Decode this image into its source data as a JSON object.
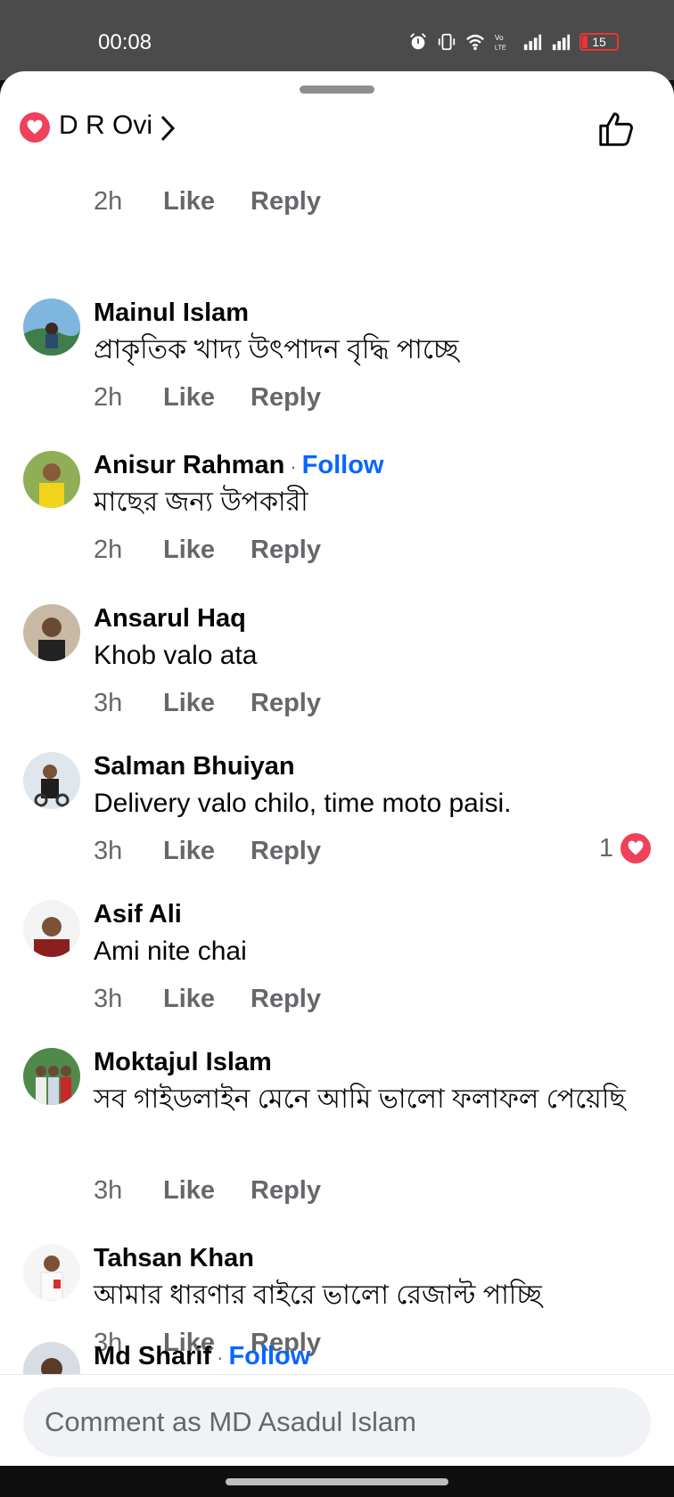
{
  "status_bar": {
    "time": "00:08",
    "battery": "15",
    "icons": [
      "alarm-icon",
      "vibrate-icon",
      "wifi-icon",
      "volte-icon",
      "signal-icon",
      "signal-icon",
      "battery-icon"
    ]
  },
  "header": {
    "page_name": "D R Ovi",
    "heart_icon": "heart-icon",
    "chevron_icon": "chevron-right-icon",
    "like_icon": "thumbs-up-icon"
  },
  "prev_comment_meta": {
    "time": "2h",
    "like": "Like",
    "reply": "Reply"
  },
  "comments": [
    {
      "name": "Mainul Islam",
      "text": "প্রাকৃতিক খাদ্য উৎপাদন বৃদ্ধি পাচ্ছে",
      "time": "2h",
      "like": "Like",
      "reply": "Reply"
    },
    {
      "name": "Anisur Rahman",
      "follow": "Follow",
      "text": "মাছের জন্য উপকারী",
      "time": "2h",
      "like": "Like",
      "reply": "Reply"
    },
    {
      "name": "Ansarul Haq",
      "text": "Khob valo ata",
      "time": "3h",
      "like": "Like",
      "reply": "Reply"
    },
    {
      "name": "Salman Bhuiyan",
      "text": "Delivery valo chilo, time moto paisi.",
      "time": "3h",
      "like": "Like",
      "reply": "Reply",
      "reaction_count": "1"
    },
    {
      "name": "Asif Ali",
      "text": "Ami nite chai",
      "time": "3h",
      "like": "Like",
      "reply": "Reply"
    },
    {
      "name": "Moktajul Islam",
      "text": "সব গাইডলাইন মেনে আমি ভালো ফলাফল পেয়েছি",
      "time": "3h",
      "like": "Like",
      "reply": "Reply"
    },
    {
      "name": "Tahsan Khan",
      "text": "আমার ধারণার বাইরে ভালো রেজাল্ট পাচ্ছি",
      "time": "3h",
      "like": "Like",
      "reply": "Reply"
    },
    {
      "name": "Md Sharif",
      "follow": "Follow"
    }
  ],
  "composer": {
    "placeholder": "Comment as MD Asadul Islam"
  },
  "colors": {
    "accent": "#0866ff",
    "heart": "#f0405a",
    "muted": "#65676b"
  }
}
